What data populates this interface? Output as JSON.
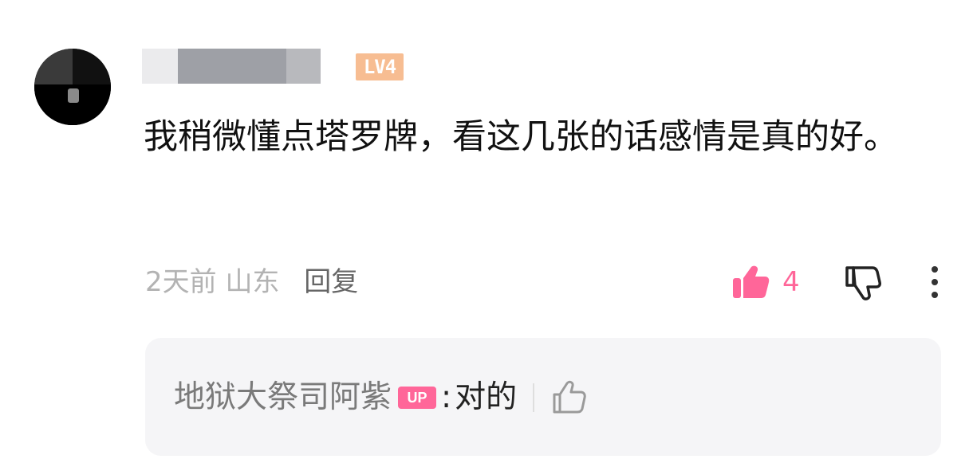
{
  "comment": {
    "level_badge": "LV4",
    "text": "我稍微懂点塔罗牌，看这几张的话感情是真的好。",
    "time": "2天前",
    "location": "山东",
    "reply_label": "回复",
    "like_count": "4",
    "accent_color": "#ff6699"
  },
  "sub_reply": {
    "author": "地狱大祭司阿紫",
    "up_badge": "UP",
    "separator": ":",
    "content": "对的"
  },
  "icons": {
    "like": "thumbs-up-filled-icon",
    "dislike": "thumbs-down-outline-icon",
    "more": "vertical-dots-icon",
    "reply_like": "thumbs-up-outline-icon"
  }
}
